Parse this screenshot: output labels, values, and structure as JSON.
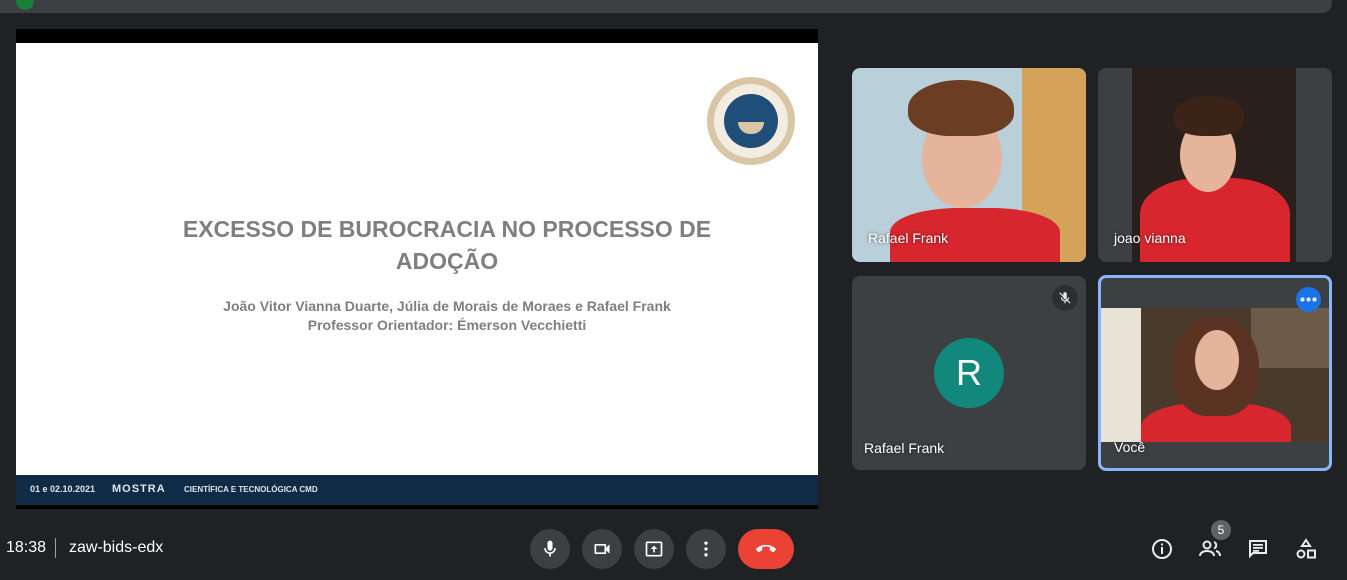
{
  "slide": {
    "title_line1": "EXCESSO DE BUROCRACIA NO PROCESSO DE",
    "title_line2": "ADOÇÃO",
    "authors": "João Vitor Vianna Duarte, Júlia de Morais de Moraes e Rafael Frank",
    "advisor": "Professor Orientador: Émerson Vecchietti",
    "footer_dates": "01 e 02.10.2021",
    "footer_mostra": "MOSTRA",
    "footer_sub": "CIENTÍFICA E TECNOLÓGICA CMD"
  },
  "participants": [
    {
      "name": "Rafael Frank"
    },
    {
      "name": "joao vianna"
    },
    {
      "name": "Rafael Frank",
      "initial": "R"
    },
    {
      "name": "Você"
    }
  ],
  "meeting": {
    "time": "18:38",
    "code": "zaw-bids-edx",
    "people_count": "5"
  },
  "colors": {
    "background": "#202124",
    "tile": "#3c4043",
    "hangup": "#ea4335",
    "avatar": "#12877b",
    "accent": "#8ab4f8"
  },
  "icons": [
    "mic-icon",
    "camera-icon",
    "present-icon",
    "more-vert-icon",
    "call-end-icon",
    "info-icon",
    "people-icon",
    "chat-icon",
    "activities-icon",
    "mic-off-icon",
    "more-horiz-icon"
  ]
}
